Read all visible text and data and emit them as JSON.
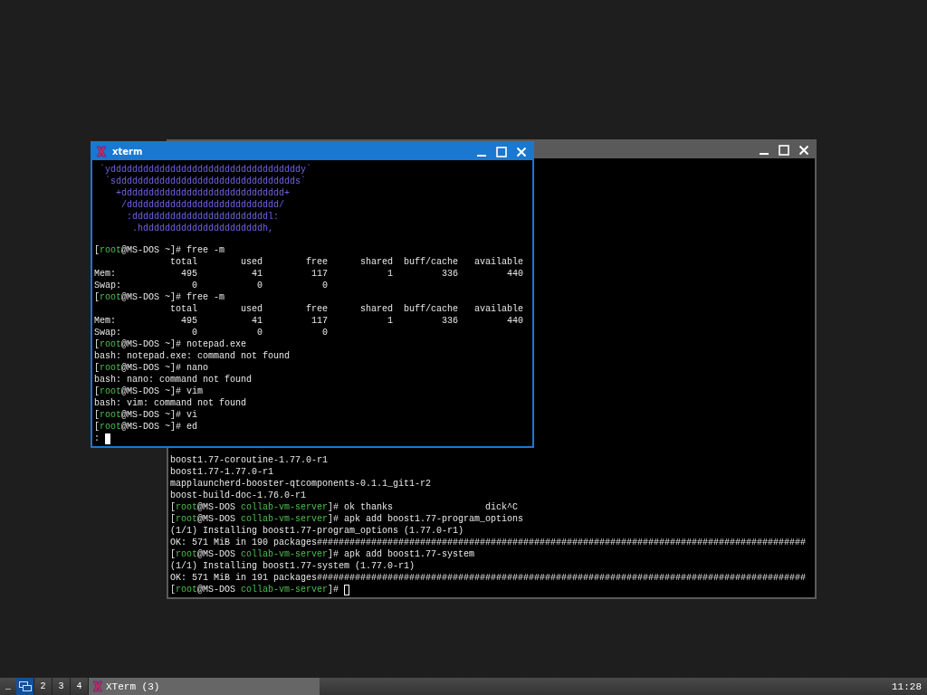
{
  "windows": [
    {
      "active": false,
      "terminal": {
        "cursor_filled": false,
        "lines": [
          {
            "kind": "output",
            "text": "boost1.77-coroutine-1.77.0-r1"
          },
          {
            "kind": "output",
            "text": "boost1.77-1.77.0-r1"
          },
          {
            "kind": "output",
            "text": "mapplauncherd-booster-qtcomponents-0.1.1_git1-r2"
          },
          {
            "kind": "output",
            "text": "boost-build-doc-1.76.0-r1"
          },
          {
            "kind": "prompt",
            "parts": [
              "[",
              "root",
              "@MS-DOS ",
              "collab-vm-server",
              "]# ok thanks                 dick^C"
            ]
          },
          {
            "kind": "prompt",
            "parts": [
              "[",
              "root",
              "@MS-DOS ",
              "collab-vm-server",
              "]# apk add boost1.77-program_options"
            ]
          },
          {
            "kind": "output",
            "text": "(1/1) Installing boost1.77-program_options (1.77.0-r1)"
          },
          {
            "kind": "output",
            "text": "OK: 571 MiB in 190 packages##########################################################################################"
          },
          {
            "kind": "prompt",
            "parts": [
              "[",
              "root",
              "@MS-DOS ",
              "collab-vm-server",
              "]# apk add boost1.77-system"
            ]
          },
          {
            "kind": "output",
            "text": "(1/1) Installing boost1.77-system (1.77.0-r1)"
          },
          {
            "kind": "output",
            "text": "OK: 571 MiB in 191 packages##########################################################################################"
          },
          {
            "kind": "prompt",
            "cursor": true,
            "parts": [
              "[",
              "root",
              "@MS-DOS ",
              "collab-vm-server",
              "]#"
            ]
          }
        ]
      }
    },
    {
      "title": "xterm",
      "active": true,
      "terminal": {
        "cursor_filled": true,
        "lines": [
          {
            "kind": "logo",
            "text": " `ydddddddddddddddddddddddddddddddddddy`"
          },
          {
            "kind": "logo",
            "text": "  `sddddddddddddddddddddddddddddddddds`"
          },
          {
            "kind": "logo",
            "text": "    +dddddddddddddddddddddddddddddd+"
          },
          {
            "kind": "logo",
            "text": "     /dddddddddddddddddddddddddddd/"
          },
          {
            "kind": "logo",
            "text": "      :dddddddddddddddddddddddddl:"
          },
          {
            "kind": "logo",
            "text": "       .hddddddddddddddddddddddh,"
          },
          {
            "kind": "blank"
          },
          {
            "kind": "prompt",
            "parts": [
              "[",
              "root",
              "@MS-DOS ~]# free -m"
            ]
          },
          {
            "kind": "output",
            "text": "              total        used        free      shared  buff/cache   available"
          },
          {
            "kind": "output",
            "text": "Mem:            495          41         117           1         336         440"
          },
          {
            "kind": "output",
            "text": "Swap:             0           0           0"
          },
          {
            "kind": "prompt",
            "parts": [
              "[",
              "root",
              "@MS-DOS ~]# free -m"
            ]
          },
          {
            "kind": "output",
            "text": "              total        used        free      shared  buff/cache   available"
          },
          {
            "kind": "output",
            "text": "Mem:            495          41         117           1         336         440"
          },
          {
            "kind": "output",
            "text": "Swap:             0           0           0"
          },
          {
            "kind": "prompt",
            "parts": [
              "[",
              "root",
              "@MS-DOS ~]# notepad.exe"
            ]
          },
          {
            "kind": "output",
            "text": "bash: notepad.exe: command not found"
          },
          {
            "kind": "prompt",
            "parts": [
              "[",
              "root",
              "@MS-DOS ~]# nano"
            ]
          },
          {
            "kind": "output",
            "text": "bash: nano: command not found"
          },
          {
            "kind": "prompt",
            "parts": [
              "[",
              "root",
              "@MS-DOS ~]# vim"
            ]
          },
          {
            "kind": "output",
            "text": "bash: vim: command not found"
          },
          {
            "kind": "prompt",
            "parts": [
              "[",
              "root",
              "@MS-DOS ~]# vi"
            ]
          },
          {
            "kind": "prompt",
            "parts": [
              "[",
              "root",
              "@MS-DOS ~]# ed"
            ]
          },
          {
            "kind": "input",
            "text": ":",
            "cursor": true
          }
        ]
      }
    }
  ],
  "taskbar": {
    "show_desktop": "_",
    "desktops": [
      {
        "selected": true
      },
      {
        "label": "2",
        "selected": false
      },
      {
        "label": "3",
        "selected": false
      },
      {
        "label": "4",
        "selected": false
      }
    ],
    "tasks": [
      {
        "label": "XTerm (3)",
        "selected": true
      }
    ],
    "clock": "11:28"
  }
}
